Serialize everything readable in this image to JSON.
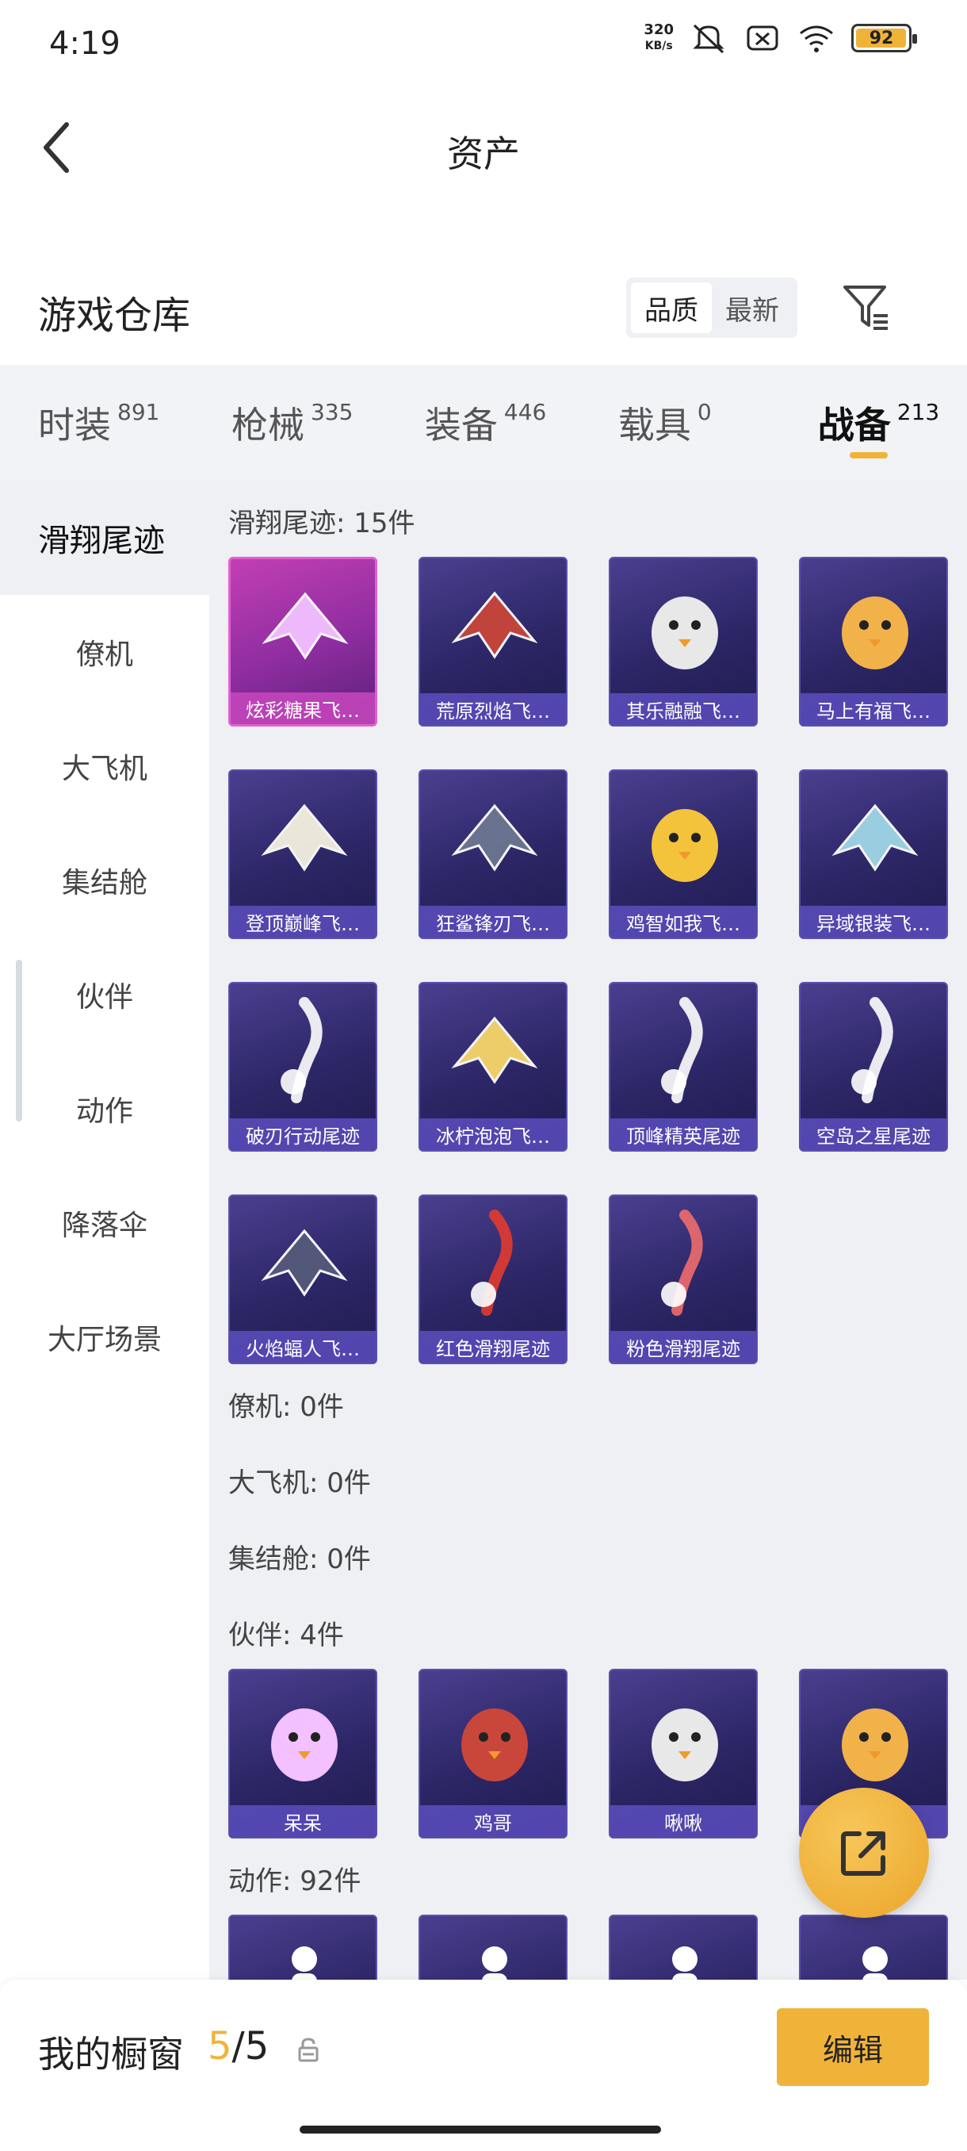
{
  "status_bar": {
    "time": "4:19",
    "speed": "320",
    "speed_unit": "KB/s",
    "battery": "92",
    "icons": [
      "mute-icon",
      "sim-off-icon",
      "wifi-icon",
      "battery-icon"
    ]
  },
  "header": {
    "title": "资产",
    "back_icon": "chevron-left-icon"
  },
  "warehouse": {
    "title": "游戏仓库",
    "sort_options": [
      "品质",
      "最新"
    ],
    "sort_selected": "品质",
    "filter_icon": "filter-icon"
  },
  "tabs": [
    {
      "label": "时装",
      "count": "891"
    },
    {
      "label": "枪械",
      "count": "335"
    },
    {
      "label": "装备",
      "count": "446"
    },
    {
      "label": "载具",
      "count": "0"
    },
    {
      "label": "战备",
      "count": "213"
    }
  ],
  "active_tab": "战备",
  "sidebar": {
    "items": [
      "滑翔尾迹",
      "僚机",
      "大飞机",
      "集结舱",
      "伙伴",
      "动作",
      "降落伞",
      "大厅场景"
    ],
    "active": "滑翔尾迹"
  },
  "sections": {
    "glide": {
      "title": "滑翔尾迹: 15件",
      "items": [
        "炫彩糖果飞…",
        "荒原烈焰飞…",
        "其乐融融飞…",
        "马上有福飞…",
        "登顶巅峰飞…",
        "狂鲨锋刃飞…",
        "鸡智如我飞…",
        "异域银装飞…",
        "破刃行动尾迹",
        "冰柠泡泡飞…",
        "顶峰精英尾迹",
        "空岛之星尾迹",
        "火焰蝠人飞…",
        "红色滑翔尾迹",
        "粉色滑翔尾迹"
      ]
    },
    "wingman": {
      "title": "僚机: 0件"
    },
    "plane": {
      "title": "大飞机: 0件"
    },
    "pod": {
      "title": "集结舱: 0件"
    },
    "companion": {
      "title": "伙伴: 4件",
      "items": [
        "呆呆",
        "鸡哥",
        "啾啾",
        ""
      ]
    },
    "emote": {
      "title": "动作: 92件"
    }
  },
  "bottom_bar": {
    "label": "我的橱窗",
    "count_current": "5",
    "count_sep": "/",
    "count_total": "5",
    "edit_label": "编辑"
  },
  "colors": {
    "accent": "#f0b33a",
    "card_bg": "#2c2666",
    "card_highlight": "#c23fb4"
  }
}
